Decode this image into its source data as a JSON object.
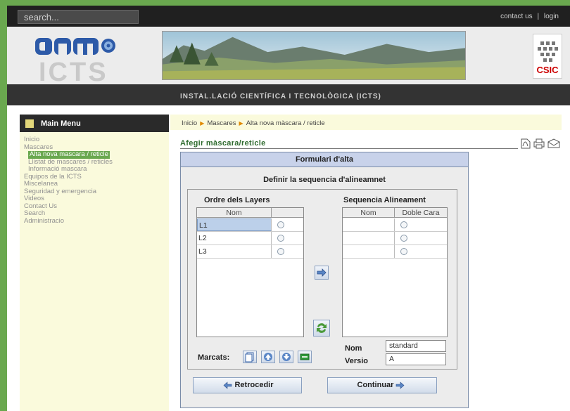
{
  "header": {
    "search_placeholder": "search...",
    "links": [
      "contact us",
      "login"
    ],
    "link_separator": "|",
    "logo_text": "ICTS",
    "csic_text": "CSIC",
    "subtitle": "INSTAL.LACIÓ CIENTÍFICA I TECNOLÒGICA (ICTS)"
  },
  "menu": {
    "title": "Main Menu",
    "items": [
      {
        "label": "Inicio",
        "level": 0
      },
      {
        "label": "Mascares",
        "level": 0
      },
      {
        "label": "Alta nova mascara / reticle",
        "level": 1,
        "active": true
      },
      {
        "label": "Llistat de mascares / reticles",
        "level": 1
      },
      {
        "label": "Informació mascara",
        "level": 1
      },
      {
        "label": "Equipos de la ICTS",
        "level": 0
      },
      {
        "label": "Miscelanea",
        "level": 0
      },
      {
        "label": "Seguridad y emergencia",
        "level": 0
      },
      {
        "label": "Videos",
        "level": 0
      },
      {
        "label": "Contact Us",
        "level": 0
      },
      {
        "label": "Search",
        "level": 0
      },
      {
        "label": "Administracio",
        "level": 0
      }
    ]
  },
  "breadcrumb": [
    "Inicio",
    "Mascares",
    "Alta nova màscara / reticle"
  ],
  "section_title": "Afegir màscara/reticle",
  "form": {
    "title": "Formulari d'alta",
    "subtitle": "Definir la sequencia d'alineamnet",
    "left_panel": {
      "label": "Ordre dels Layers",
      "columns": [
        "Nom",
        ""
      ],
      "rows": [
        "L1",
        "L2",
        "L3"
      ],
      "selected_row": 0
    },
    "right_panel": {
      "label": "Sequencia Alineament",
      "columns": [
        "Nom",
        "Doble Cara"
      ],
      "rows": [
        "",
        "",
        ""
      ]
    },
    "marcats_label": "Marcats:",
    "nom_label": "Nom",
    "nom_value": "standard",
    "versio_label": "Versio",
    "versio_value": "A",
    "back_button": "Retrocedir",
    "continue_button": "Continuar"
  },
  "colors": {
    "accent_green": "#6aa84f",
    "form_header": "#c8d2ea",
    "menu_bg": "#fafadc"
  }
}
